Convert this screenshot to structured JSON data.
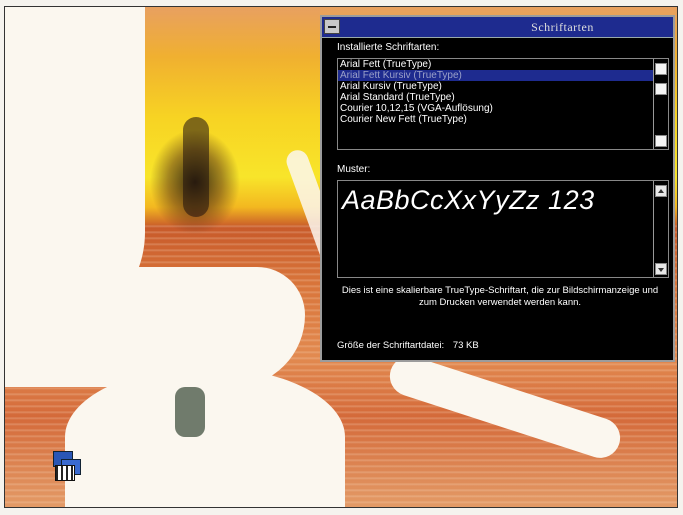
{
  "dialog": {
    "title": "Schriftarten",
    "installed_label": "Installierte Schriftarten:",
    "fonts": [
      {
        "name": "Arial Fett (TrueType)",
        "selected": false
      },
      {
        "name": "Arial Fett Kursiv (TrueType)",
        "selected": true
      },
      {
        "name": "Arial Kursiv (TrueType)",
        "selected": false
      },
      {
        "name": "Arial Standard (TrueType)",
        "selected": false
      },
      {
        "name": "Courier 10,12,15 (VGA-Auflösung)",
        "selected": false
      },
      {
        "name": "Courier New Fett (TrueType)",
        "selected": false
      }
    ],
    "sample_label": "Muster:",
    "sample_text": "AaBbCcXxYyZz 123",
    "description": "Dies ist eine skalierbare TrueType-Schriftart, die zur Bildschirmanzeige und zum Drucken verwendet werden kann.",
    "file_size_label": "Größe der Schriftartdatei:",
    "file_size_value": "73 KB"
  },
  "desktop": {
    "icon": "program-group-icon",
    "accent_colors": {
      "titlebar": "#1e2b8f",
      "selection": "#1e2b8f",
      "dialog_bg": "#000000"
    }
  }
}
